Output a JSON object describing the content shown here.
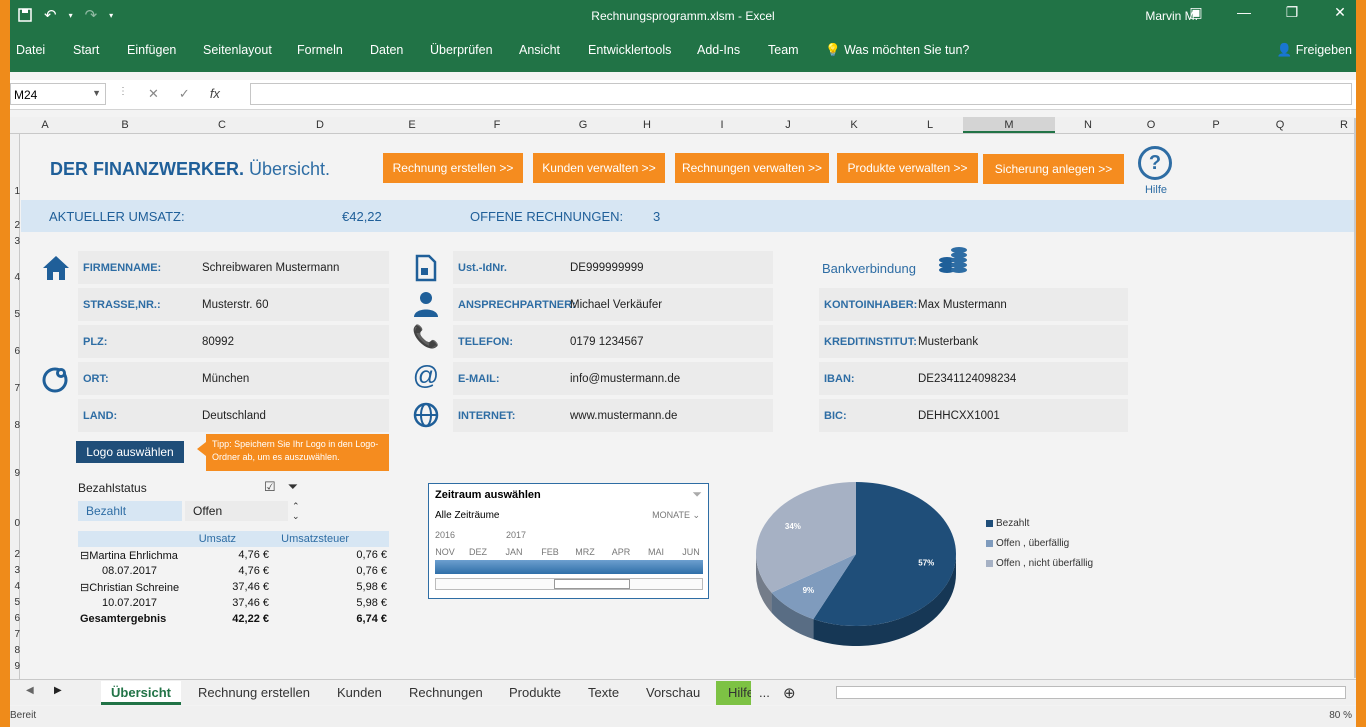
{
  "titlebar": {
    "doc_title": "Rechnungsprogramm.xlsm  -  Excel",
    "user": "Marvin M."
  },
  "ribbon": {
    "tabs": [
      "Datei",
      "Start",
      "Einfügen",
      "Seitenlayout",
      "Formeln",
      "Daten",
      "Überprüfen",
      "Ansicht",
      "Entwicklertools",
      "Add-Ins",
      "Team"
    ],
    "tell_me": "Was möchten Sie tun?",
    "share": "Freigeben"
  },
  "formula_bar": {
    "name_box": "M24",
    "fx": "fx",
    "formula": ""
  },
  "columns": [
    "A",
    "B",
    "C",
    "D",
    "E",
    "F",
    "G",
    "H",
    "I",
    "J",
    "K",
    "L",
    "M",
    "N",
    "O",
    "P",
    "Q",
    "R"
  ],
  "rows": [
    "1",
    "2",
    "3",
    "4",
    "5",
    "6",
    "7",
    "8",
    "9",
    "0",
    "2",
    "3",
    "4",
    "5",
    "6",
    "7",
    "8",
    "9"
  ],
  "dashboard": {
    "brand_bold": "DER FINANZWERKER.",
    "brand_light": "Übersicht.",
    "nav_buttons": [
      "Rechnung erstellen >>",
      "Kunden verwalten >>",
      "Rechnungen verwalten >>",
      "Produkte verwalten >>",
      "Sicherung anlegen >>"
    ],
    "help_label": "Hilfe",
    "kpi": {
      "umsatz_label": "AKTUELLER UMSATZ:",
      "umsatz_value": "€42,22",
      "offen_label": "OFFENE RECHNUNGEN:",
      "offen_value": "3"
    },
    "company": [
      {
        "label": "FIRMENNAME:",
        "value": "Schreibwaren Mustermann"
      },
      {
        "label": "STRASSE,NR.:",
        "value": "Musterstr. 60"
      },
      {
        "label": "PLZ:",
        "value": "80992"
      },
      {
        "label": "ORT:",
        "value": "München"
      },
      {
        "label": "LAND:",
        "value": "Deutschland"
      }
    ],
    "contact": [
      {
        "label": "Ust.-IdNr.",
        "value": "DE999999999"
      },
      {
        "label": "ANSPRECHPARTNER:",
        "value": "Michael Verkäufer"
      },
      {
        "label": "TELEFON:",
        "value": "0179 1234567"
      },
      {
        "label": "E-MAIL:",
        "value": "info@mustermann.de"
      },
      {
        "label": "INTERNET:",
        "value": "www.mustermann.de"
      }
    ],
    "bank_title": "Bankverbindung",
    "bank": [
      {
        "label": "KONTOINHABER:",
        "value": "Max Mustermann"
      },
      {
        "label": "KREDITINSTITUT:",
        "value": "Musterbank"
      },
      {
        "label": "IBAN:",
        "value": "DE2341124098234"
      },
      {
        "label": "BIC:",
        "value": "DEHHCXX1001"
      }
    ],
    "logo_button": "Logo auswählen",
    "tip": "Tipp: Speichern Sie Ihr Logo in den Logo-Ordner ab, um es auszuwählen.",
    "slicer": {
      "title": "Bezahlstatus",
      "items": [
        "Bezahlt",
        "Offen"
      ]
    },
    "pivot": {
      "headers": [
        "Umsatz",
        "Umsatzsteuer"
      ],
      "rows": [
        {
          "name": "⊟Martina Ehrlichma",
          "umsatz": "4,76 €",
          "steuer": "0,76 €",
          "indent": false,
          "bold": false
        },
        {
          "name": "08.07.2017",
          "umsatz": "4,76 €",
          "steuer": "0,76 €",
          "indent": true,
          "bold": false
        },
        {
          "name": "⊟Christian Schreine",
          "umsatz": "37,46 €",
          "steuer": "5,98 €",
          "indent": false,
          "bold": false
        },
        {
          "name": "10.07.2017",
          "umsatz": "37,46 €",
          "steuer": "5,98 €",
          "indent": true,
          "bold": false
        },
        {
          "name": "Gesamtergebnis",
          "umsatz": "42,22 €",
          "steuer": "6,74 €",
          "indent": false,
          "bold": true
        }
      ]
    },
    "timeline": {
      "title": "Zeitraum auswählen",
      "all": "Alle Zeiträume",
      "level": "MONATE ⌄",
      "years": [
        "2016",
        "2017"
      ],
      "months": [
        "NOV",
        "DEZ",
        "JAN",
        "FEB",
        "MRZ",
        "APR",
        "MAI",
        "JUN"
      ]
    }
  },
  "chart_data": {
    "type": "pie",
    "categories": [
      "Bezahlt",
      "Offen , überfällig",
      "Offen , nicht überfällig"
    ],
    "values": [
      57,
      9,
      34
    ],
    "value_labels": [
      "57%",
      "9%",
      "34%"
    ],
    "colors": [
      "#1f4e79",
      "#7f9bbd",
      "#a6b1c4"
    ],
    "legend": "right"
  },
  "sheet_tabs": [
    "Übersicht",
    "Rechnung erstellen",
    "Kunden",
    "Rechnungen",
    "Produkte",
    "Texte",
    "Vorschau",
    "Hilfe"
  ],
  "more_tabs": "...",
  "status": {
    "left": "Bereit",
    "zoom": "80 %"
  }
}
